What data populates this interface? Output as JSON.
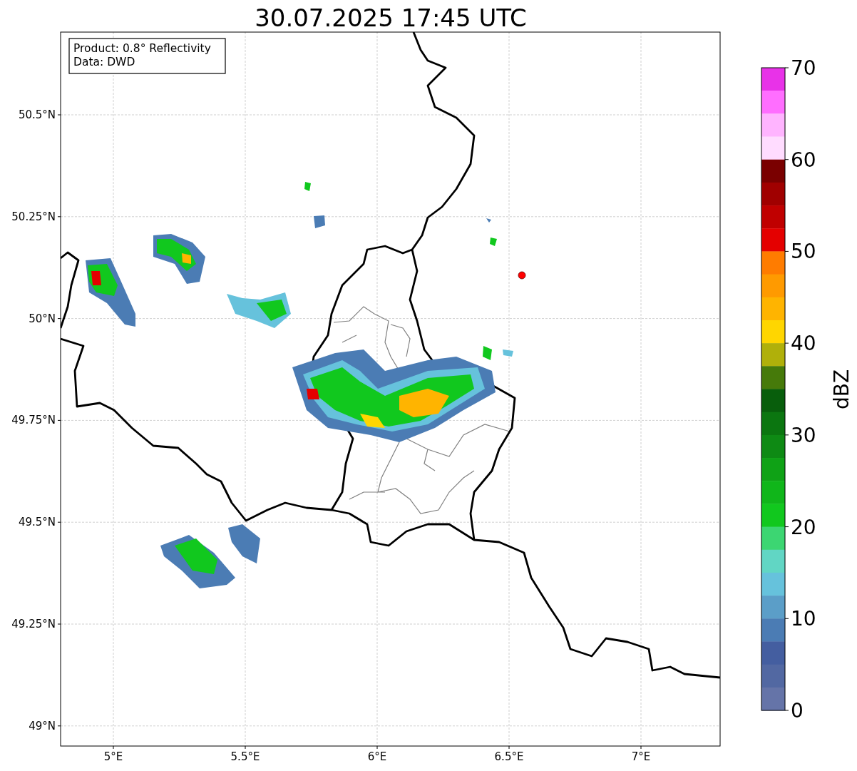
{
  "title": "30.07.2025 17:45 UTC",
  "info_box": [
    "Product: 0.8° Reflectivity",
    "Data: DWD"
  ],
  "map": {
    "x_ticks": [
      "5°E",
      "5.5°E",
      "6°E",
      "6.5°E",
      "7°E"
    ],
    "y_ticks": [
      "50.5°N",
      "50.25°N",
      "50°N",
      "49.75°N",
      "49.5°N",
      "49.25°N",
      "49°N"
    ]
  },
  "colorbar": {
    "label": "dBZ",
    "ticks": [
      "70",
      "60",
      "50",
      "40",
      "30",
      "20",
      "10",
      "0"
    ],
    "bands": [
      {
        "color": "#e832e8"
      },
      {
        "color": "#ff6eff"
      },
      {
        "color": "#ffb4ff"
      },
      {
        "color": "#ffdcff"
      },
      {
        "color": "#7a0000"
      },
      {
        "color": "#a00000"
      },
      {
        "color": "#c00000"
      },
      {
        "color": "#e40000"
      },
      {
        "color": "#ff7c00"
      },
      {
        "color": "#ff9a00"
      },
      {
        "color": "#ffb400"
      },
      {
        "color": "#ffd600"
      },
      {
        "color": "#b0b00a"
      },
      {
        "color": "#467a0a"
      },
      {
        "color": "#085e0c"
      },
      {
        "color": "#0b7610"
      },
      {
        "color": "#0e8a14"
      },
      {
        "color": "#0fa216"
      },
      {
        "color": "#10b61a"
      },
      {
        "color": "#11c81e"
      },
      {
        "color": "#3cd672"
      },
      {
        "color": "#61d6c4"
      },
      {
        "color": "#66c2dc"
      },
      {
        "color": "#5b9ec8"
      },
      {
        "color": "#4b7cb4"
      },
      {
        "color": "#445ea0"
      },
      {
        "color": "#5268a2"
      },
      {
        "color": "#6574a8"
      }
    ]
  }
}
